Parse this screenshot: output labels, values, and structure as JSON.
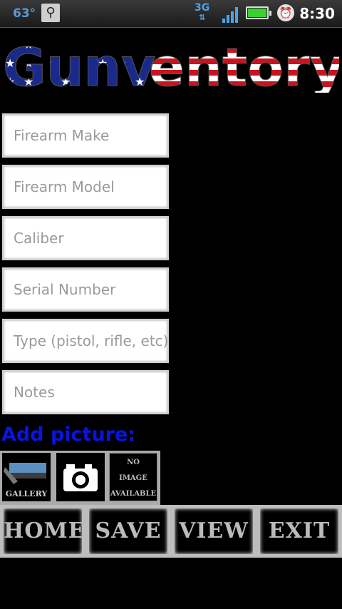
{
  "status_bar": {
    "temperature": "63°",
    "network": "3G",
    "time": "8:30"
  },
  "app": {
    "logo_part1": "Gunv",
    "logo_part2": "entory"
  },
  "form": {
    "fields": [
      {
        "placeholder": "Firearm Make",
        "value": ""
      },
      {
        "placeholder": "Firearm Model",
        "value": ""
      },
      {
        "placeholder": "Caliber",
        "value": ""
      },
      {
        "placeholder": "Serial Number",
        "value": ""
      },
      {
        "placeholder": "Type (pistol, rifle, etc)",
        "value": ""
      },
      {
        "placeholder": "Notes",
        "value": ""
      }
    ]
  },
  "picture": {
    "heading": "Add picture:",
    "gallery_label": "GALLERY",
    "no_image_line1": "NO",
    "no_image_line2": "IMAGE",
    "no_image_line3": "AVAILABLE"
  },
  "nav": {
    "home": "HOME",
    "save": "SAVE",
    "view": "VIEW",
    "exit": "EXIT"
  }
}
